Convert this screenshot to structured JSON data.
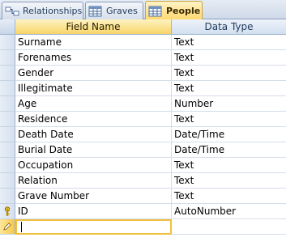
{
  "tabs": [
    {
      "label": "Relationships",
      "icon": "relationships-icon",
      "active": false
    },
    {
      "label": "Graves",
      "icon": "table-icon",
      "active": false
    },
    {
      "label": "People",
      "icon": "table-icon",
      "active": true
    }
  ],
  "headers": {
    "field_name": "Field Name",
    "data_type": "Data Type"
  },
  "fields": [
    {
      "name": "Surname",
      "type": "Text"
    },
    {
      "name": "Forenames",
      "type": "Text"
    },
    {
      "name": "Gender",
      "type": "Text"
    },
    {
      "name": "Illegitimate",
      "type": "Text"
    },
    {
      "name": "Age",
      "type": "Number"
    },
    {
      "name": "Residence",
      "type": "Text"
    },
    {
      "name": "Death Date",
      "type": "Date/Time"
    },
    {
      "name": "Burial Date",
      "type": "Date/Time"
    },
    {
      "name": "Occupation",
      "type": "Text"
    },
    {
      "name": "Relation",
      "type": "Text"
    },
    {
      "name": "Grave Number",
      "type": "Text"
    },
    {
      "name": "ID",
      "type": "AutoNumber",
      "primary_key": true
    }
  ],
  "new_row": {
    "name": "",
    "type": ""
  }
}
